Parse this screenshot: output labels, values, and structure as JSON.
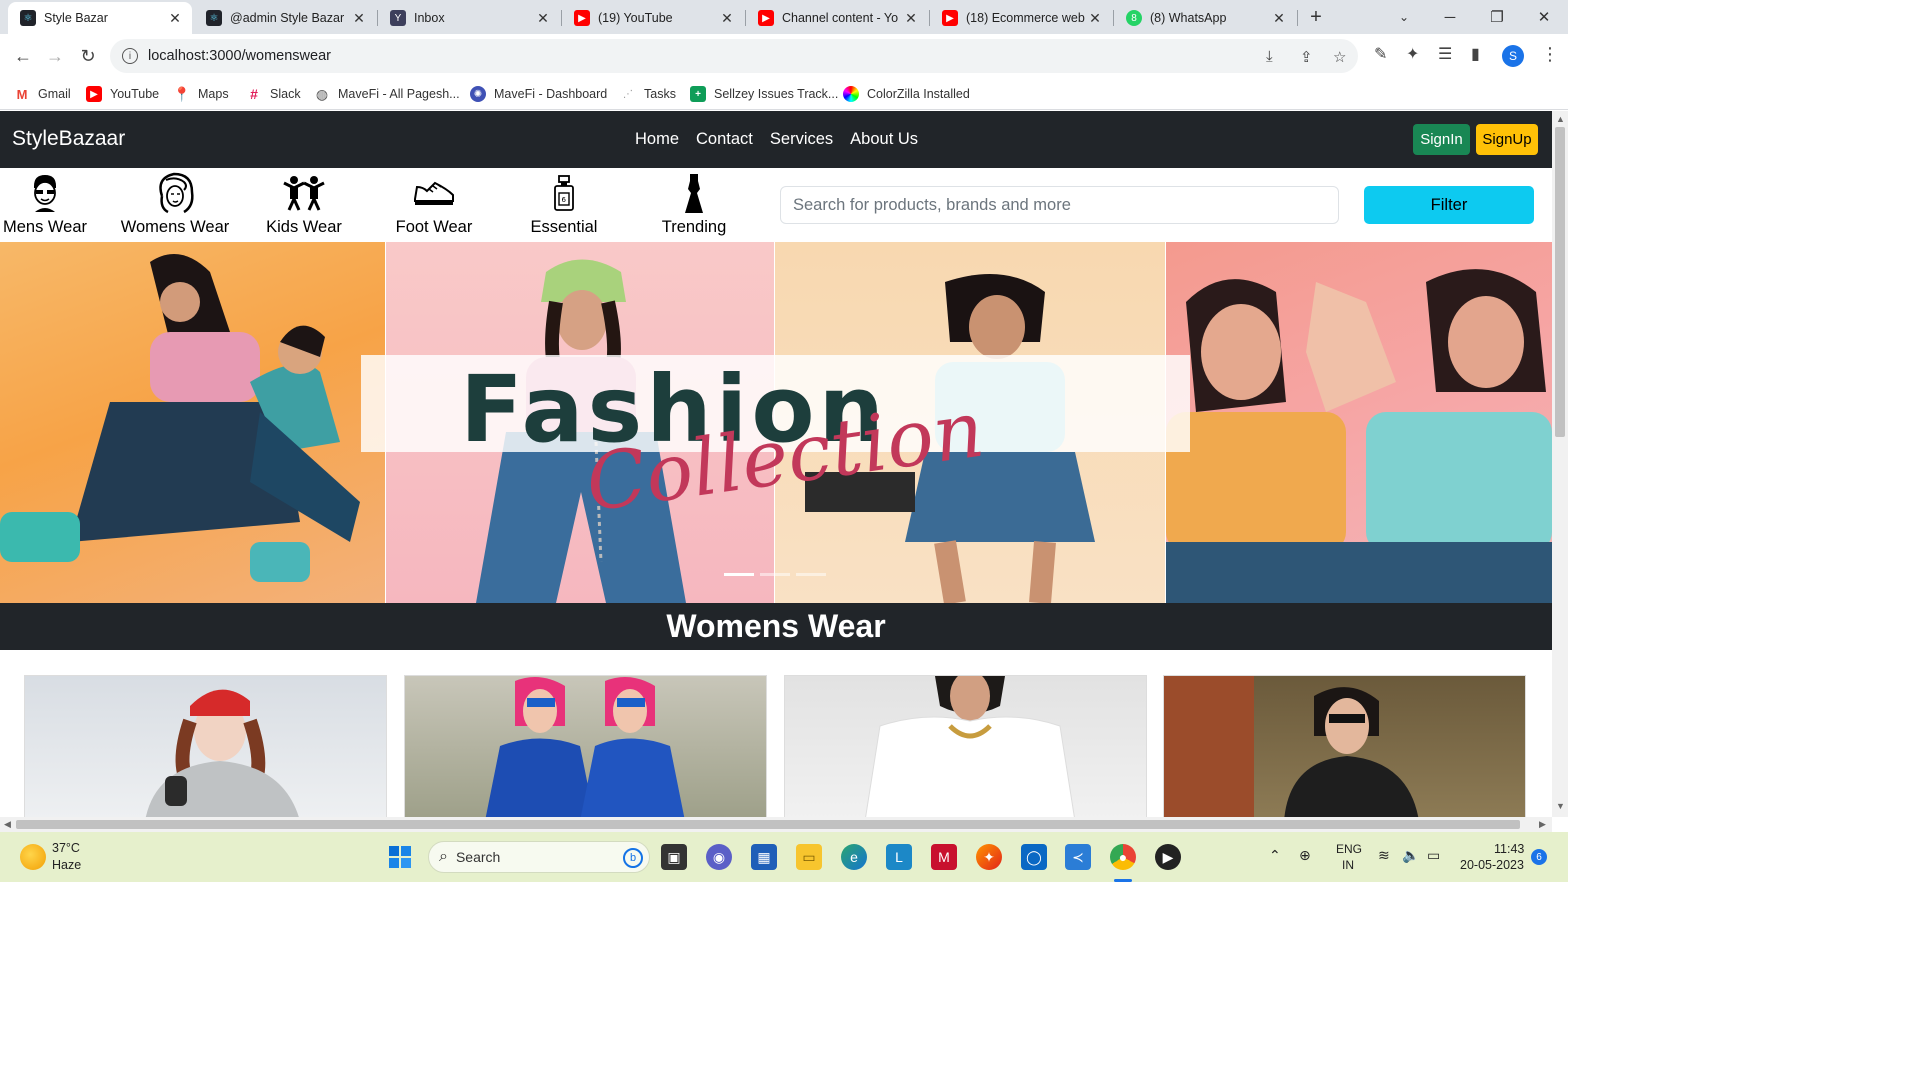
{
  "browser": {
    "tabs": [
      {
        "title": "Style Bazar",
        "active": true,
        "icon": "react-icon"
      },
      {
        "title": "@admin Style Bazar",
        "active": false,
        "icon": "react-icon"
      },
      {
        "title": "Inbox",
        "active": false,
        "icon": "yahoo-icon"
      },
      {
        "title": "(19) YouTube",
        "active": false,
        "icon": "youtube-icon"
      },
      {
        "title": "Channel content - Yo",
        "active": false,
        "icon": "youtube-icon"
      },
      {
        "title": "(18) Ecommerce web",
        "active": false,
        "icon": "youtube-icon"
      },
      {
        "title": "(8) WhatsApp",
        "active": false,
        "icon": "whatsapp-icon"
      }
    ],
    "new_tab": "+",
    "url": "localhost:3000/womenswear",
    "avatar_letter": "S",
    "bookmarks": [
      {
        "label": "Gmail",
        "icon": "gmail-icon"
      },
      {
        "label": "YouTube",
        "icon": "youtube-icon"
      },
      {
        "label": "Maps",
        "icon": "maps-icon"
      },
      {
        "label": "Slack",
        "icon": "slack-icon"
      },
      {
        "label": "MaveFi - All Pagesh...",
        "icon": "globe-icon"
      },
      {
        "label": "MaveFi - Dashboard",
        "icon": "mavefi-icon"
      },
      {
        "label": "Tasks",
        "icon": "tasks-icon"
      },
      {
        "label": "Sellzey Issues Track...",
        "icon": "sheets-icon"
      },
      {
        "label": "ColorZilla Installed",
        "icon": "colorzilla-icon"
      }
    ]
  },
  "site": {
    "brand": "StyleBazaar",
    "nav": [
      "Home",
      "Contact",
      "Services",
      "About Us"
    ],
    "signin": "SignIn",
    "signup": "SignUp",
    "categories": [
      "Mens Wear",
      "Womens Wear",
      "Kids Wear",
      "Foot Wear",
      "Essential",
      "Trending"
    ],
    "search_placeholder": "Search for products, brands and more",
    "filter_label": "Filter",
    "hero": {
      "title": "Fashion",
      "script": "Collection",
      "slides": 3,
      "active_slide": 1
    },
    "section_title": "Womens Wear"
  },
  "taskbar": {
    "weather_temp": "37°C",
    "weather_desc": "Haze",
    "search_label": "Search",
    "lang": "ENG",
    "region": "IN",
    "time": "11:43",
    "date": "20-05-2023",
    "notification_count": "6"
  },
  "colors": {
    "navbar": "#212529",
    "signin": "#198754",
    "signup": "#ffc107",
    "filter": "#0dcaf0",
    "taskbar": "#e6f0cc"
  }
}
